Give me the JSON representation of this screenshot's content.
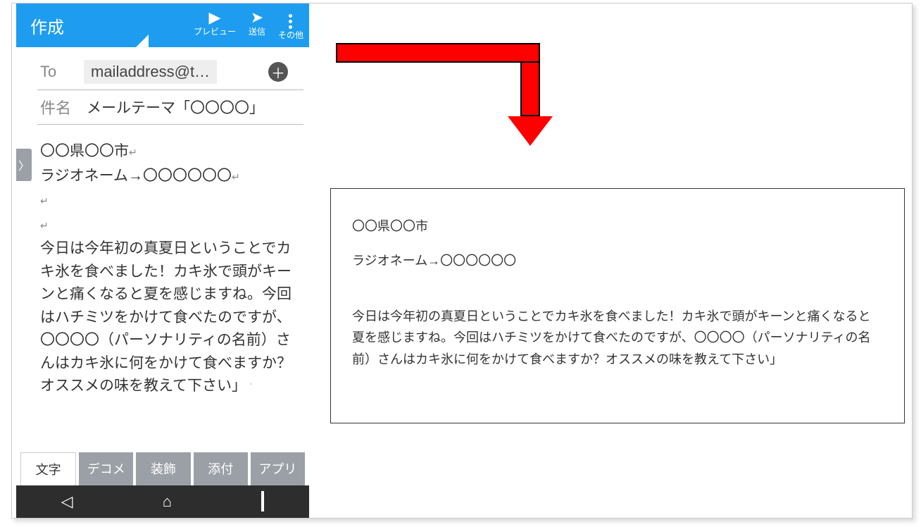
{
  "titlebar": {
    "title": "作成",
    "preview": "プレビュー",
    "send": "送信",
    "more": "その他"
  },
  "to": {
    "label": "To",
    "address": "mailaddress@t…"
  },
  "subject": {
    "label": "件名",
    "value": "メールテーマ「〇〇〇〇」"
  },
  "body": {
    "line1": "〇〇県〇〇市",
    "line2": "ラジオネーム→〇〇〇〇〇〇",
    "para": "今日は今年初の真夏日ということでカキ氷を食べました！カキ氷で頭がキーンと痛くなると夏を感じますね。今回はハチミツをかけて食べたのですが、〇〇〇〇（パーソナリティの名前）さんはカキ氷に何をかけて食べますか？オススメの味を教えて下さい」"
  },
  "tabs": {
    "t1": "文字",
    "t2": "デコメ",
    "t3": "装飾",
    "t4": "添付",
    "t5": "アプリ"
  },
  "output": {
    "line1": "〇〇県〇〇市",
    "line2": "ラジオネーム→〇〇〇〇〇〇",
    "para": "今日は今年初の真夏日ということでカキ氷を食べました！カキ氷で頭がキーンと痛くなると夏を感じますね。今回はハチミツをかけて食べたのですが、〇〇〇〇（パーソナリティの名前）さんはカキ氷に何をかけて食べますか？オススメの味を教えて下さい」"
  }
}
